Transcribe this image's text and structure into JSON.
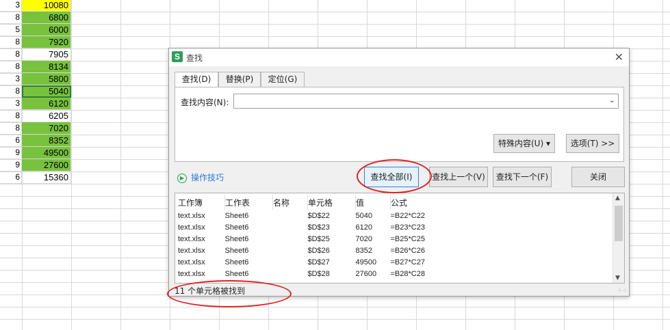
{
  "sheet": {
    "left_col": [
      "3",
      "8",
      "5",
      "8",
      "8",
      "8",
      "3",
      "8",
      "3",
      "8",
      "8",
      "6",
      "9",
      "9",
      "6"
    ],
    "values": [
      "10080",
      "6800",
      "6000",
      "7920",
      "7905",
      "8134",
      "5800",
      "5040",
      "6120",
      "6205",
      "7020",
      "8352",
      "49500",
      "27600",
      "15360"
    ],
    "fills": [
      "yellow",
      "green",
      "green",
      "green",
      "white",
      "green",
      "green",
      "green",
      "green",
      "white",
      "green",
      "green",
      "green",
      "green",
      "white"
    ],
    "selected_index": 7
  },
  "dialog": {
    "app_icon": "S",
    "title": "查找",
    "close_icon": "✕",
    "tabs": [
      {
        "label": "查找(D)",
        "active": true
      },
      {
        "label": "替换(P)",
        "active": false
      },
      {
        "label": "定位(G)",
        "active": false
      }
    ],
    "find_label": "查找内容(N):",
    "find_value": "",
    "special_button": "特殊内容(U) ▾",
    "options_button": "选项(T) >>",
    "tips_label": "操作技巧",
    "find_all_button": "查找全部(I)",
    "find_prev_button": "查找上一个(V)",
    "find_next_button": "查找下一个(F)",
    "close_button": "关闭",
    "results": {
      "columns": [
        "工作簿",
        "工作表",
        "名称",
        "单元格",
        "值",
        "公式"
      ],
      "rows": [
        [
          "text.xlsx",
          "Sheet6",
          "",
          "$D$22",
          "5040",
          "=B22*C22"
        ],
        [
          "text.xlsx",
          "Sheet6",
          "",
          "$D$23",
          "6120",
          "=B23*C23"
        ],
        [
          "text.xlsx",
          "Sheet6",
          "",
          "$D$25",
          "7020",
          "=B25*C25"
        ],
        [
          "text.xlsx",
          "Sheet6",
          "",
          "$D$26",
          "8352",
          "=B26*C26"
        ],
        [
          "text.xlsx",
          "Sheet6",
          "",
          "$D$27",
          "49500",
          "=B27*C27"
        ],
        [
          "text.xlsx",
          "Sheet6",
          "",
          "$D$28",
          "27600",
          "=B28*C28"
        ]
      ]
    },
    "status": "11 个单元格被找到"
  },
  "colors": {
    "accent_red": "#e02020",
    "cell_green": "#78c23e",
    "cell_yellow": "#ffff00"
  }
}
